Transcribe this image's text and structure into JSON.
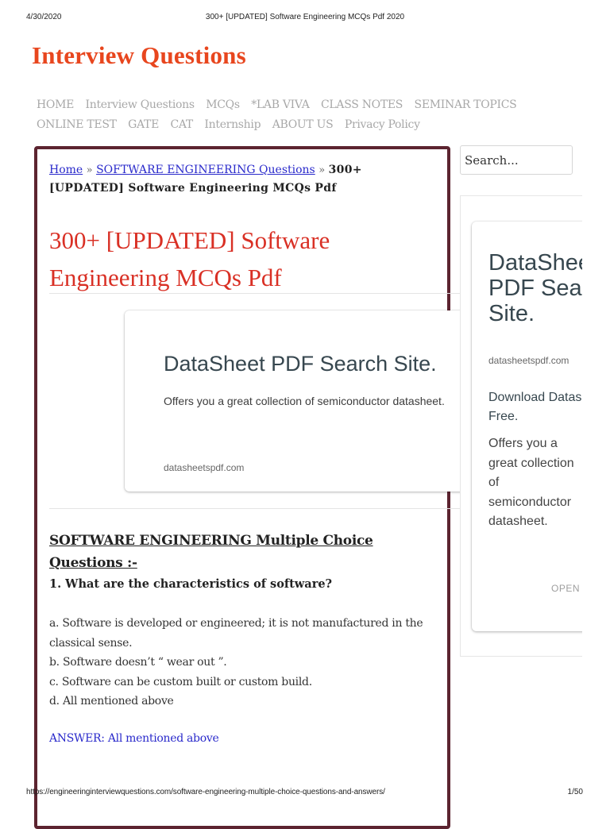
{
  "pdf": {
    "date": "4/30/2020",
    "title": "300+ [UPDATED] Software Engineering MCQs Pdf 2020",
    "url": "https://engineeringinterviewquestions.com/software-engineering-multiple-choice-questions-and-answers/",
    "page": "1/50"
  },
  "site": {
    "title": "Interview Questions",
    "brand_color": "#e8461e"
  },
  "nav": {
    "items": [
      {
        "label": "HOME"
      },
      {
        "label": "Interview Questions"
      },
      {
        "label": "MCQs"
      },
      {
        "label": "*LAB VIVA"
      },
      {
        "label": "CLASS NOTES"
      },
      {
        "label": "SEMINAR TOPICS"
      },
      {
        "label": "ONLINE TEST"
      },
      {
        "label": "GATE"
      },
      {
        "label": "CAT"
      },
      {
        "label": "Internship"
      },
      {
        "label": "ABOUT US"
      },
      {
        "label": "Privacy Policy"
      }
    ]
  },
  "breadcrumb": {
    "home": "Home",
    "separator": "»",
    "category": "SOFTWARE ENGINEERING Questions",
    "current": "300+ [UPDATED] Software Engineering MCQs Pdf"
  },
  "article": {
    "title": "300+ [UPDATED] Software Engineering MCQs Pdf",
    "title_color": "#d93025",
    "section_heading": "SOFTWARE ENGINEERING Multiple Choice Questions :-",
    "questions": [
      {
        "question": "1. What are the characteristics of software?",
        "options": [
          "a. Software is developed or engineered; it is not manufactured in the classical sense.",
          "b. Software doesn’t “ wear out ”.",
          "c. Software can be custom built or custom build.",
          "d. All mentioned above"
        ],
        "answer": "ANSWER: All mentioned above"
      }
    ]
  },
  "ad_inline": {
    "headline": "DataSheet PDF Search Site.",
    "description": "Offers you a great collection of semiconductor datasheet.",
    "domain": "datasheetspdf.com"
  },
  "sidebar": {
    "search_placeholder": "Search...",
    "ad": {
      "headline": "DataSheet PDF Search Site.",
      "domain": "datasheetspdf.com",
      "subheadline": "Download Datasheet for Free.",
      "description": "Offers you a great collection of semiconductor datasheet.",
      "open_label": "OPEN"
    }
  },
  "colors": {
    "container_border": "#5c2430",
    "link": "#2a2acb",
    "nav_text": "#a8a8a8",
    "ad_headline": "#37474f"
  }
}
